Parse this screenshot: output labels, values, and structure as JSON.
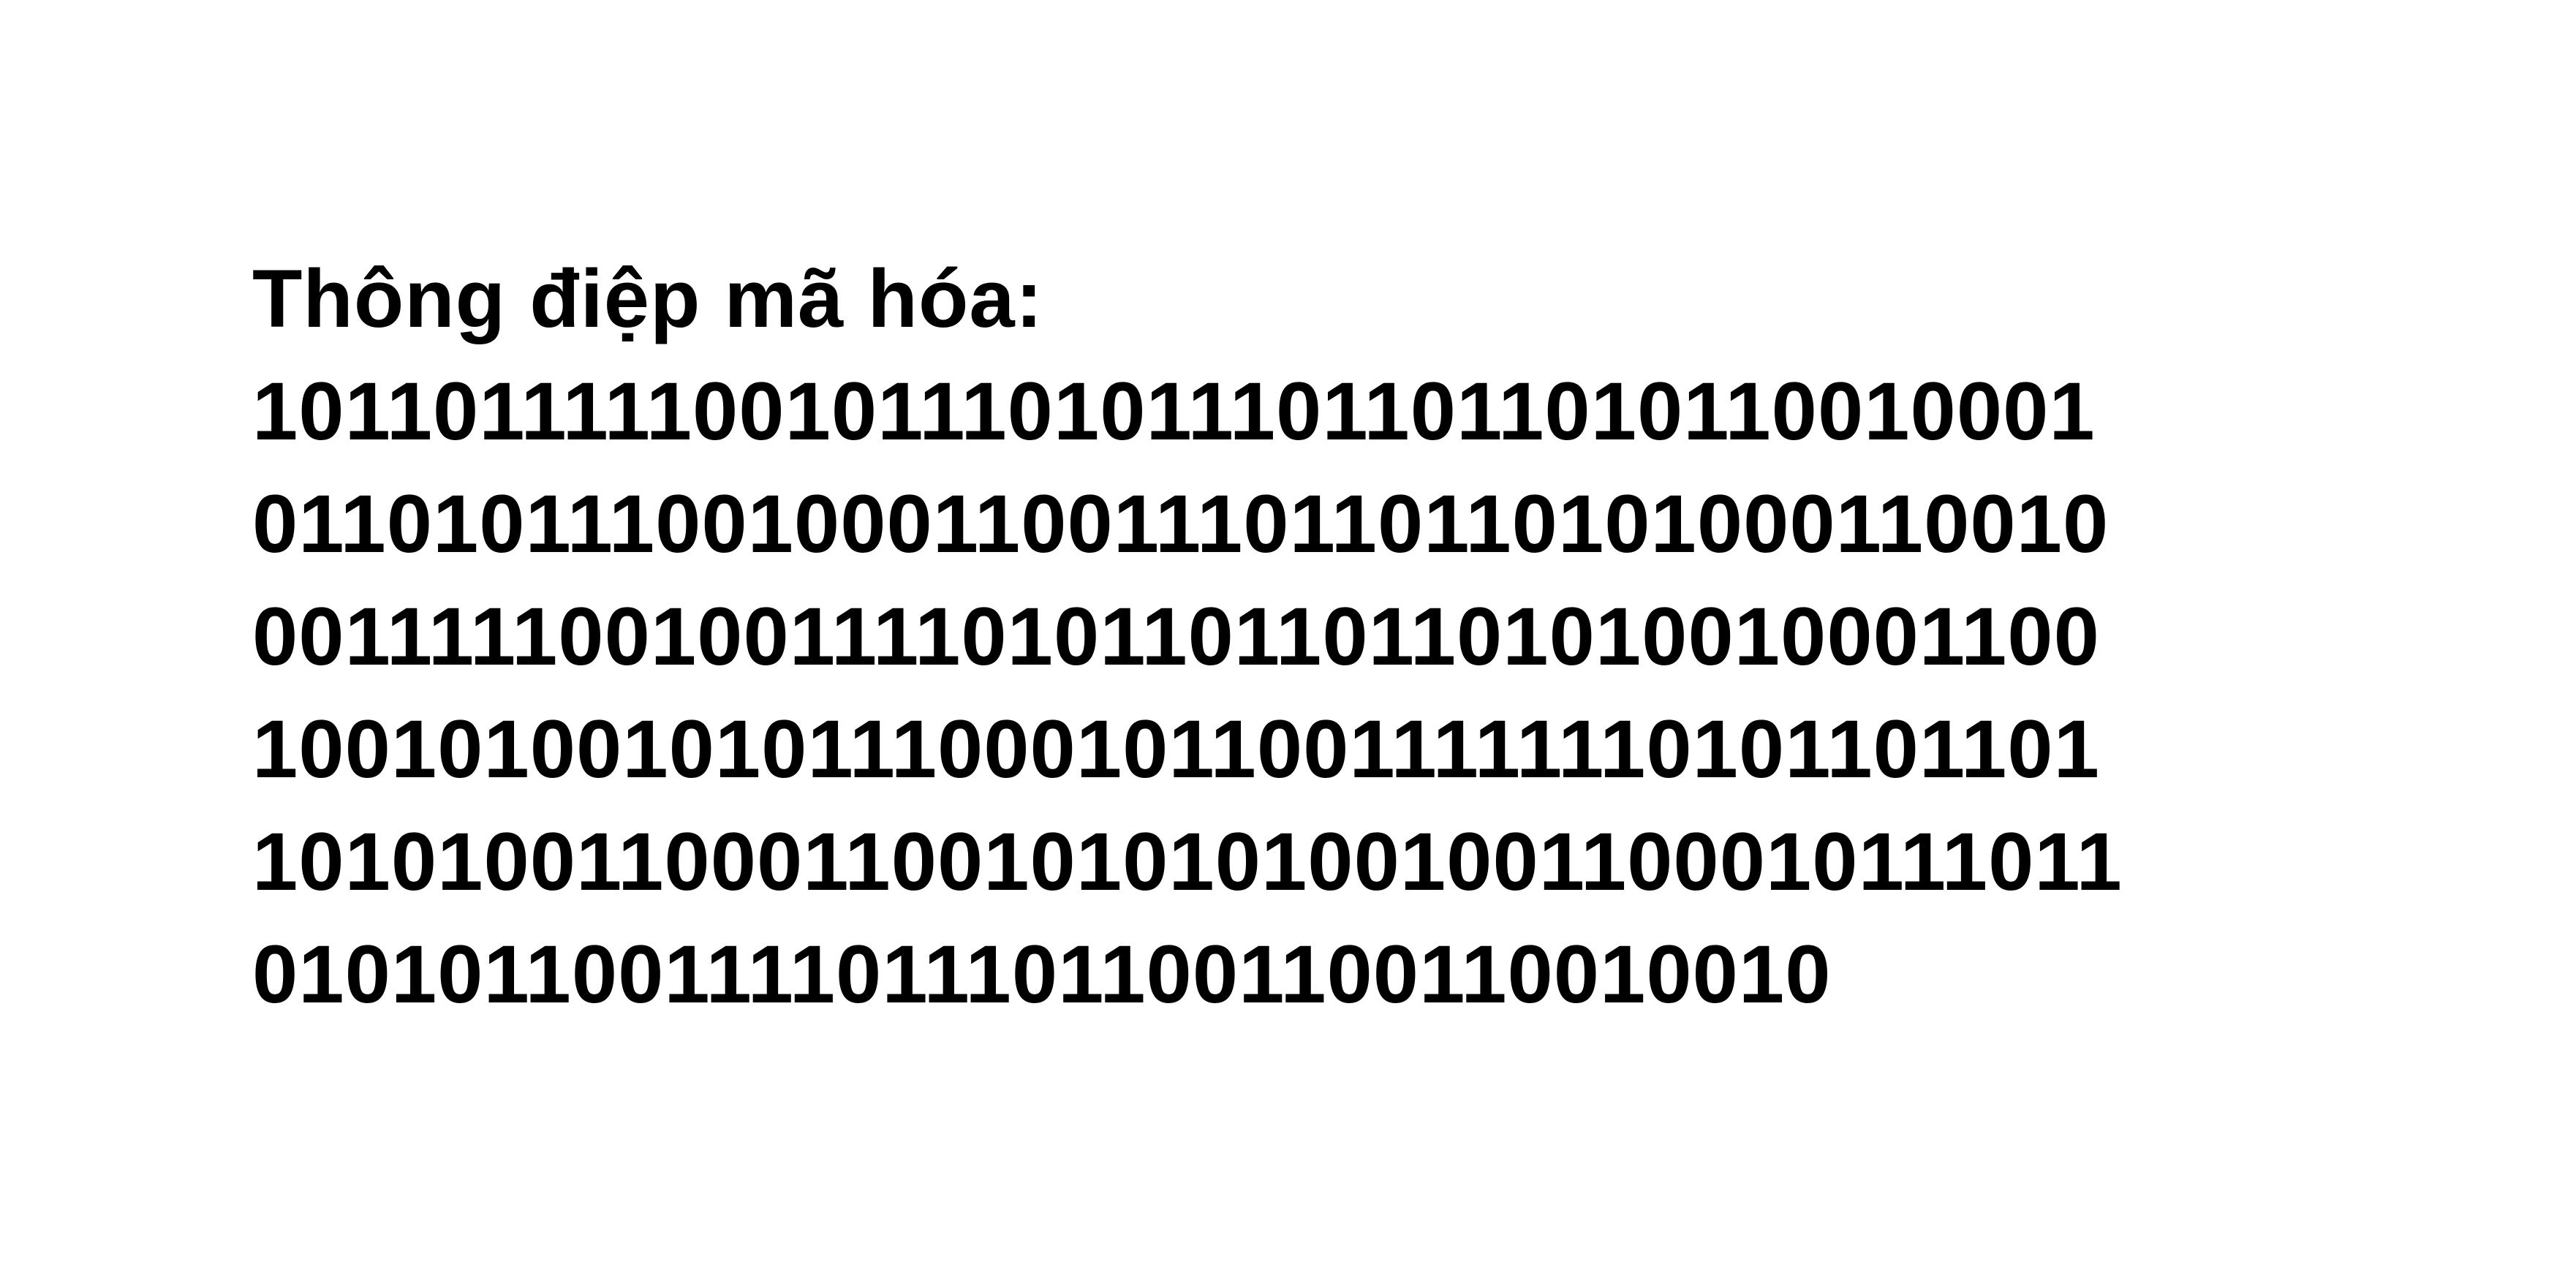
{
  "document": {
    "heading": "Thông điệp mã hóa:",
    "lines": [
      "1011011111001011101011101101101011001000​1",
      "01101011100100011001110110110101000110010",
      "00111110010011110101101101101010010001100",
      "10010100101011100010110011111110101101101",
      "10101001100011001010101001001100010111011",
      "0101011001111011101100110011001001​0"
    ]
  }
}
